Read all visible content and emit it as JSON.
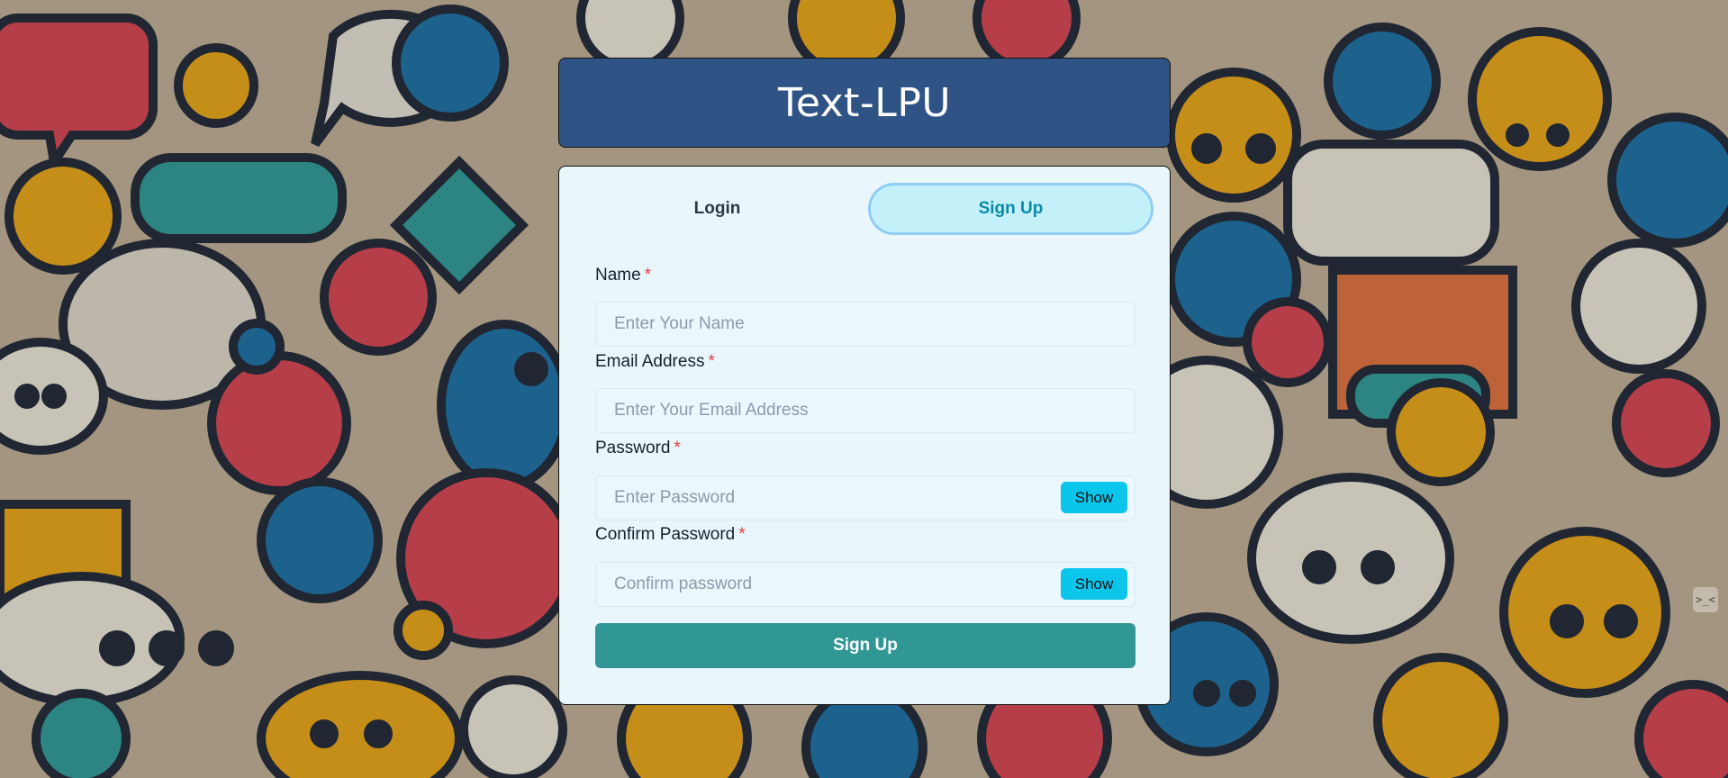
{
  "app": {
    "title": "Text-LPU"
  },
  "tabs": [
    {
      "label": "Login",
      "active": false
    },
    {
      "label": "Sign Up",
      "active": true
    }
  ],
  "form": {
    "required_marker": "*",
    "name": {
      "label": "Name",
      "placeholder": "Enter Your Name",
      "value": ""
    },
    "email": {
      "label": "Email Address",
      "placeholder": "Enter Your Email Address",
      "value": ""
    },
    "password": {
      "label": "Password",
      "placeholder": "Enter Password",
      "value": "",
      "toggle_label": "Show"
    },
    "confirm_password": {
      "label": "Confirm Password",
      "placeholder": "Confirm password",
      "value": "",
      "toggle_label": "Show"
    },
    "submit_label": "Sign Up"
  },
  "corner_icon": {
    "name": "code-toggle-icon",
    "glyph": ">_<"
  },
  "colors": {
    "header_bg": "#2f5384",
    "card_bg": "#e9f6fc",
    "active_tab_bg": "#c4f1f9",
    "active_tab_text": "#0b8aa8",
    "show_button_bg": "#0bc5ea",
    "submit_bg": "#319795",
    "required": "#e53e3e"
  }
}
